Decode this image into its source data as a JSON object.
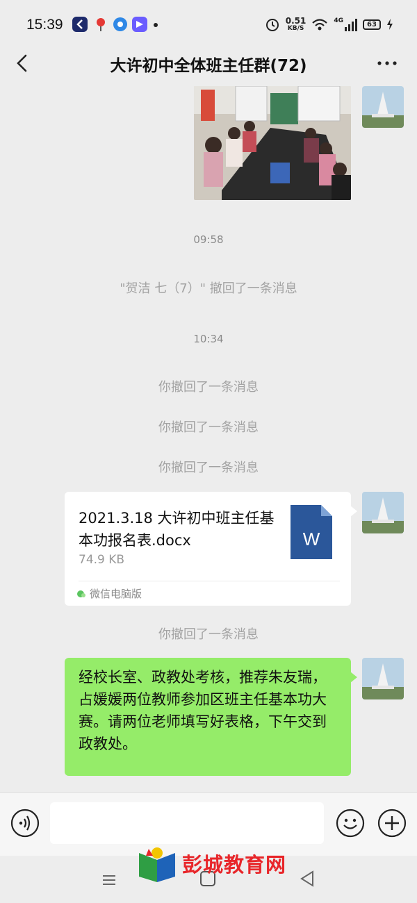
{
  "status_bar": {
    "time": "15:39",
    "network_speed_value": "0.51",
    "network_speed_unit": "KB/S",
    "signal_label": "4G",
    "battery": "63",
    "icons": [
      "app-icon-dark-blue",
      "map-pin-icon",
      "app-icon-blue-circle",
      "app-icon-purple",
      "alarm-icon",
      "wifi-icon",
      "signal-icon",
      "battery-icon",
      "charging-icon"
    ]
  },
  "header": {
    "title": "大许初中全体班主任群(72)"
  },
  "messages": {
    "time_1": "09:58",
    "recall_other": "\"贺洁 七（7）\" 撤回了一条消息",
    "time_2": "10:34",
    "recall_self_1": "你撤回了一条消息",
    "recall_self_2": "你撤回了一条消息",
    "recall_self_3": "你撤回了一条消息",
    "file": {
      "name": "2021.3.18 大许初中班主任基本功报名表.docx",
      "size": "74.9 KB",
      "source": "微信电脑版",
      "icon_letter": "W"
    },
    "recall_self_4": "你撤回了一条消息",
    "text": "经校长室、政教处考核，推荐朱友瑞，占媛媛两位教师参加区班主任基本功大赛。请两位老师填写好表格，下午交到政教处。"
  },
  "input_bar": {
    "value": ""
  },
  "watermark": {
    "text": "彭城教育网"
  },
  "colors": {
    "background": "#ededed",
    "bubble_green": "#95ec69",
    "word_blue": "#2b579a",
    "watermark_red": "#e8262a"
  }
}
